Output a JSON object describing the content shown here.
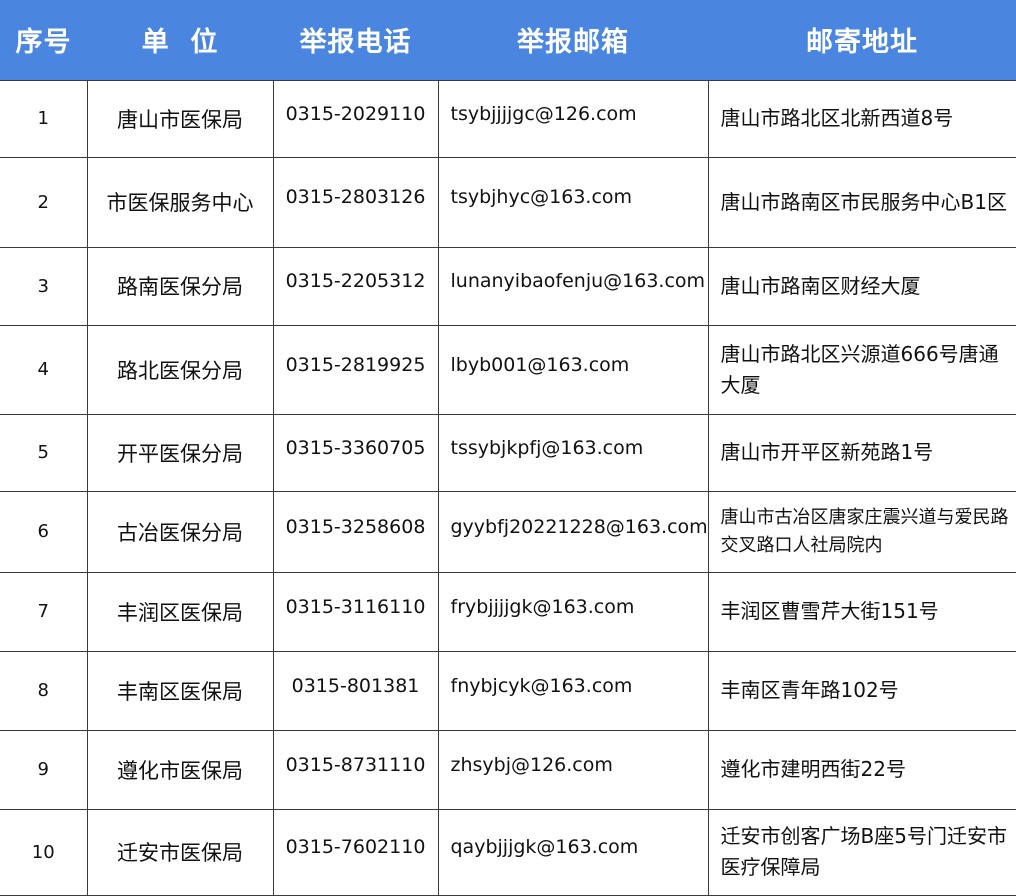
{
  "table": {
    "headers": [
      "序号",
      "单  位",
      "举报电话",
      "举报邮箱",
      "邮寄地址"
    ],
    "rows": [
      {
        "index": "1",
        "unit": "唐山市医保局",
        "phone": "0315-2029110",
        "email": "tsybjjjjgc@126.com",
        "address": "唐山市路北区北新西道8号"
      },
      {
        "index": "2",
        "unit": "市医保服务中心",
        "phone": "0315-2803126",
        "email": "tsybjhyc@163.com",
        "address": "唐山市路南区市民服务中心B1区"
      },
      {
        "index": "3",
        "unit": "路南医保分局",
        "phone": "0315-2205312",
        "email": "lunanyibaofenju@163.com",
        "address": "唐山市路南区财经大厦"
      },
      {
        "index": "4",
        "unit": "路北医保分局",
        "phone": "0315-2819925",
        "email": "lbyb001@163.com",
        "address": "唐山市路北区兴源道666号唐通大厦"
      },
      {
        "index": "5",
        "unit": "开平医保分局",
        "phone": "0315-3360705",
        "email": "tssybjkpfj@163.com",
        "address": "唐山市开平区新苑路1号"
      },
      {
        "index": "6",
        "unit": "古冶医保分局",
        "phone": "0315-3258608",
        "email": "gyybfj20221228@163.com",
        "address": "唐山市古冶区唐家庄震兴道与爱民路交叉路口人社局院内"
      },
      {
        "index": "7",
        "unit": "丰润区医保局",
        "phone": "0315-3116110",
        "email": "frybjjjjgk@163.com",
        "address": "丰润区曹雪芹大街151号"
      },
      {
        "index": "8",
        "unit": "丰南区医保局",
        "phone": "0315-801381",
        "email": "fnybjcyk@163.com",
        "address": "丰南区青年路102号"
      },
      {
        "index": "9",
        "unit": "遵化市医保局",
        "phone": "0315-8731110",
        "email": "zhsybj@126.com",
        "address": "遵化市建明西街22号"
      },
      {
        "index": "10",
        "unit": "迁安市医保局",
        "phone": "0315-7602110",
        "email": "qaybjjjgk@163.com",
        "address": "迁安市创客广场B座5号门迁安市医疗保障局"
      }
    ]
  },
  "colors": {
    "header_bg": "#4a86e0",
    "header_text": "#ffffff",
    "border": "#3a3a3a"
  }
}
